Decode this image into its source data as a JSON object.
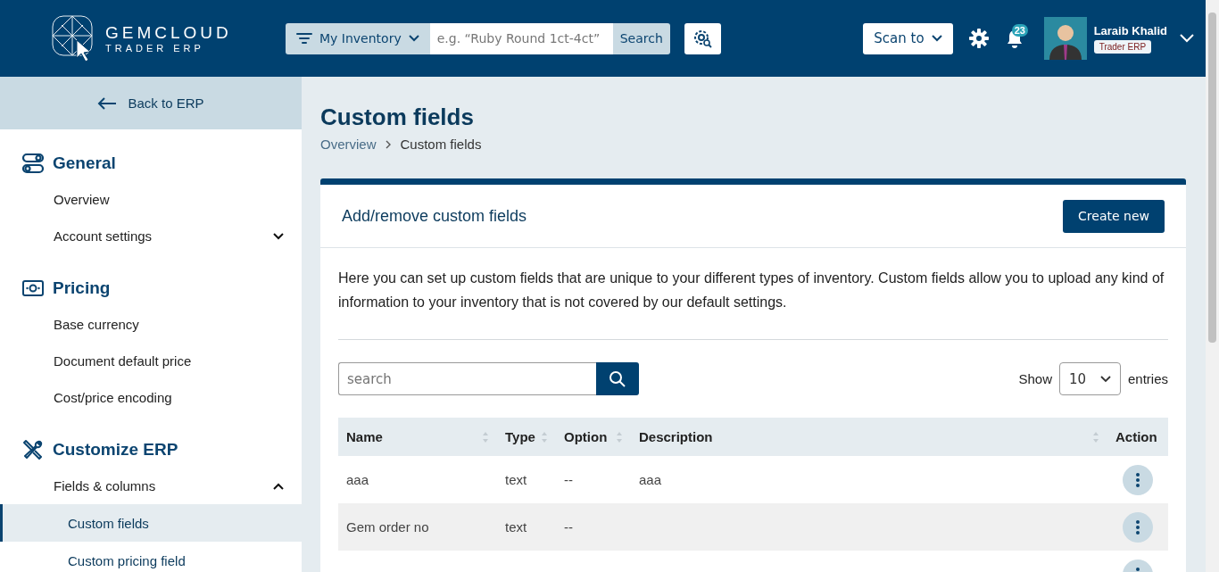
{
  "header": {
    "logo": {
      "name": "GEMCLOUD",
      "tagline": "TRADER ERP"
    },
    "search": {
      "scope": "My Inventory",
      "placeholder": "e.g. “Ruby Round 1ct-4ct”",
      "button": "Search"
    },
    "scan_button": "Scan to",
    "notifications": "23",
    "user": {
      "name": "Laraib Khalid",
      "role": "Trader ERP"
    }
  },
  "sidebar": {
    "back": "Back to ERP",
    "sections": [
      {
        "kind": "general",
        "title": "General",
        "items": [
          {
            "label": "Overview",
            "selected": false
          },
          {
            "label": "Account settings",
            "selected": false,
            "expanded": false
          }
        ]
      },
      {
        "kind": "pricing",
        "title": "Pricing",
        "items": [
          {
            "label": "Base currency",
            "selected": false
          },
          {
            "label": "Document default price",
            "selected": false
          },
          {
            "label": "Cost/price encoding",
            "selected": false
          }
        ]
      },
      {
        "kind": "customize",
        "title": "Customize ERP",
        "items": [
          {
            "label": "Fields & columns",
            "selected": false,
            "expanded": true,
            "children": [
              {
                "label": "Custom fields",
                "selected": true
              },
              {
                "label": "Custom pricing field",
                "selected": false
              }
            ]
          }
        ]
      }
    ]
  },
  "page": {
    "title": "Custom fields",
    "breadcrumb": [
      "Overview",
      "Custom fields"
    ],
    "card": {
      "title": "Add/remove custom fields",
      "create_button": "Create new",
      "description": "Here you can set up custom fields that are unique to your different types of inventory. Custom fields allow you to upload any kind of information to your inventory that is not covered by our default settings.",
      "search": {
        "placeholder": "search"
      },
      "show_label": "Show",
      "page_size": "10",
      "entries_label": "entries",
      "table": {
        "columns": [
          {
            "label": "Name",
            "sortable": true
          },
          {
            "label": "Type",
            "sortable": true
          },
          {
            "label": "Option",
            "sortable": true
          },
          {
            "label": "Description",
            "sortable": true
          },
          {
            "label": "Action",
            "sortable": false
          }
        ],
        "rows": [
          {
            "name": "aaa",
            "type": "text",
            "option": "--",
            "description": "aaa",
            "actions": true
          },
          {
            "name": "Gem order no",
            "type": "text",
            "option": "--",
            "actions": true
          },
          {
            "actions": true
          }
        ]
      }
    }
  }
}
